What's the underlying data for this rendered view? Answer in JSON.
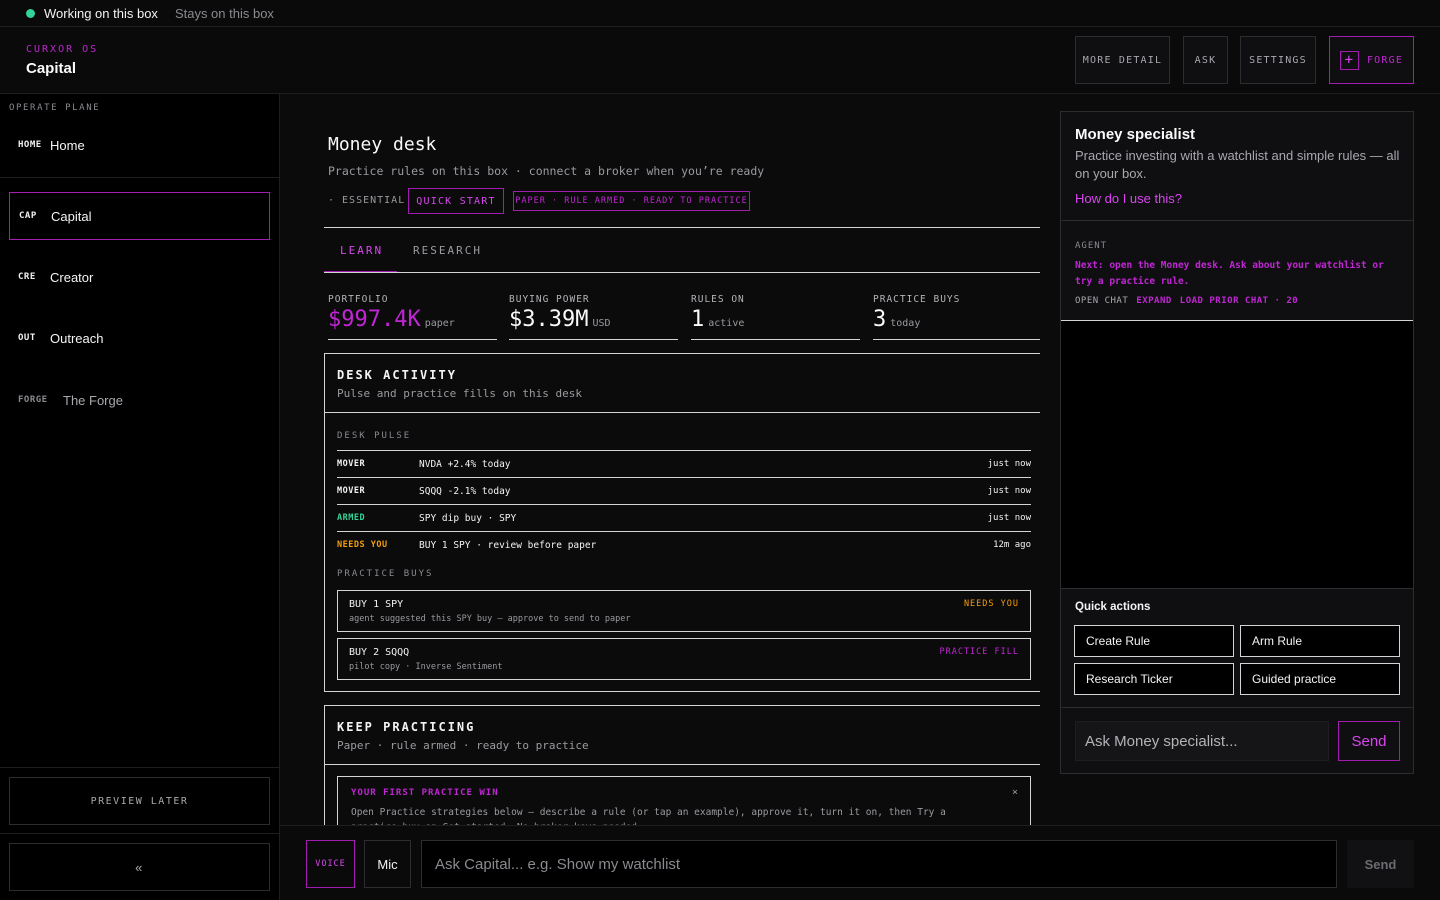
{
  "status": {
    "primary": "Working on this box",
    "secondary": "Stays on this box",
    "dot_color": "#34d399"
  },
  "header": {
    "eyebrow": "CURXOR OS",
    "title": "Capital",
    "buttons": {
      "more_detail": "MORE DETAIL",
      "ask": "ASK",
      "settings": "SETTINGS",
      "forge": "FORGE",
      "forge_icon": "plus-icon"
    }
  },
  "sidebar": {
    "eyebrow": "OPERATE PLANE",
    "items": [
      {
        "code": "HOME",
        "label": "Home"
      },
      {
        "code": "CAP",
        "label": "Capital"
      },
      {
        "code": "CRE",
        "label": "Creator"
      },
      {
        "code": "OUT",
        "label": "Outreach"
      },
      {
        "code": "FORGE",
        "label": "The Forge"
      }
    ],
    "active": "Capital",
    "preview_later": "PREVIEW LATER",
    "collapse": "«"
  },
  "desk": {
    "title": "Money desk",
    "subtitle": "Practice rules on this box · connect a broker when you’re ready",
    "essential": "· ESSENTIAL",
    "quick_start": "QUICK START",
    "paper_badge": "PAPER · RULE ARMED · READY TO PRACTICE",
    "tabs": [
      {
        "label": "LEARN",
        "active": true
      },
      {
        "label": "RESEARCH",
        "active": false
      }
    ],
    "stats": [
      {
        "label": "PORTFOLIO",
        "value": "$997.4K",
        "unit": "paper"
      },
      {
        "label": "BUYING POWER",
        "value": "$3.39M",
        "unit": "USD"
      },
      {
        "label": "RULES ON",
        "value": "1",
        "unit": "active"
      },
      {
        "label": "PRACTICE BUYS",
        "value": "3",
        "unit": "today"
      }
    ]
  },
  "activity": {
    "title": "DESK ACTIVITY",
    "subtitle": "Pulse and practice fills on this desk",
    "pulse_heading": "DESK PULSE",
    "pulse": [
      {
        "kind": "MOVER",
        "text": "NVDA +2.4% today",
        "time": "just now",
        "color": "#f4f4f5"
      },
      {
        "kind": "MOVER",
        "text": "SQQQ -2.1% today",
        "time": "just now",
        "color": "#f4f4f5"
      },
      {
        "kind": "ARMED",
        "text": "SPY dip buy · SPY",
        "time": "just now",
        "color": "#34d399"
      },
      {
        "kind": "NEEDS YOU",
        "text": "BUY 1 SPY · review before paper",
        "time": "12m ago",
        "color": "#f59e0b"
      }
    ],
    "buys_heading": "PRACTICE BUYS",
    "buys": [
      {
        "title": "BUY 1 SPY",
        "sub": "agent suggested this SPY buy — approve to send to paper",
        "status": "NEEDS YOU",
        "color": "#f59e0b"
      },
      {
        "title": "BUY 2 SQQQ",
        "sub": "pilot copy · Inverse Sentiment",
        "status": "PRACTICE FILL",
        "color": "#c026d3"
      }
    ]
  },
  "keep": {
    "title": "KEEP PRACTICING",
    "subtitle": "Paper · rule armed · ready to practice",
    "win_title": "YOUR FIRST PRACTICE WIN",
    "win_close": "×",
    "win_text": "Open Practice strategies below — describe a rule (or tap an example), approve it, turn it on, then Try a practice buy on Get started. No broker keys needed."
  },
  "composer": {
    "voice": "VOICE",
    "mic": "Mic",
    "placeholder": "Ask Capital... e.g. Show my watchlist",
    "send": "Send"
  },
  "specialist": {
    "title": "Money specialist",
    "subtitle": "Practice investing with a watchlist and simple rules — all on your box.",
    "help_link": "How do I use this?",
    "agent_label": "AGENT",
    "agent_msg": "Next: open the Money desk. Ask about your watchlist or try a practice rule.",
    "open_chat": "OPEN CHAT",
    "expand": "EXPAND",
    "load_prior": "LOAD PRIOR CHAT · 20",
    "quick_actions_label": "Quick actions",
    "quick_actions": [
      "Create Rule",
      "Arm Rule",
      "Research Ticker",
      "Guided practice"
    ],
    "input_placeholder": "Ask Money specialist...",
    "send": "Send"
  },
  "colors": {
    "accent": "#c026d3",
    "accent_border": "#a21caf",
    "positive": "#34d399",
    "warning": "#f59e0b",
    "background": "#0b0b0c"
  }
}
